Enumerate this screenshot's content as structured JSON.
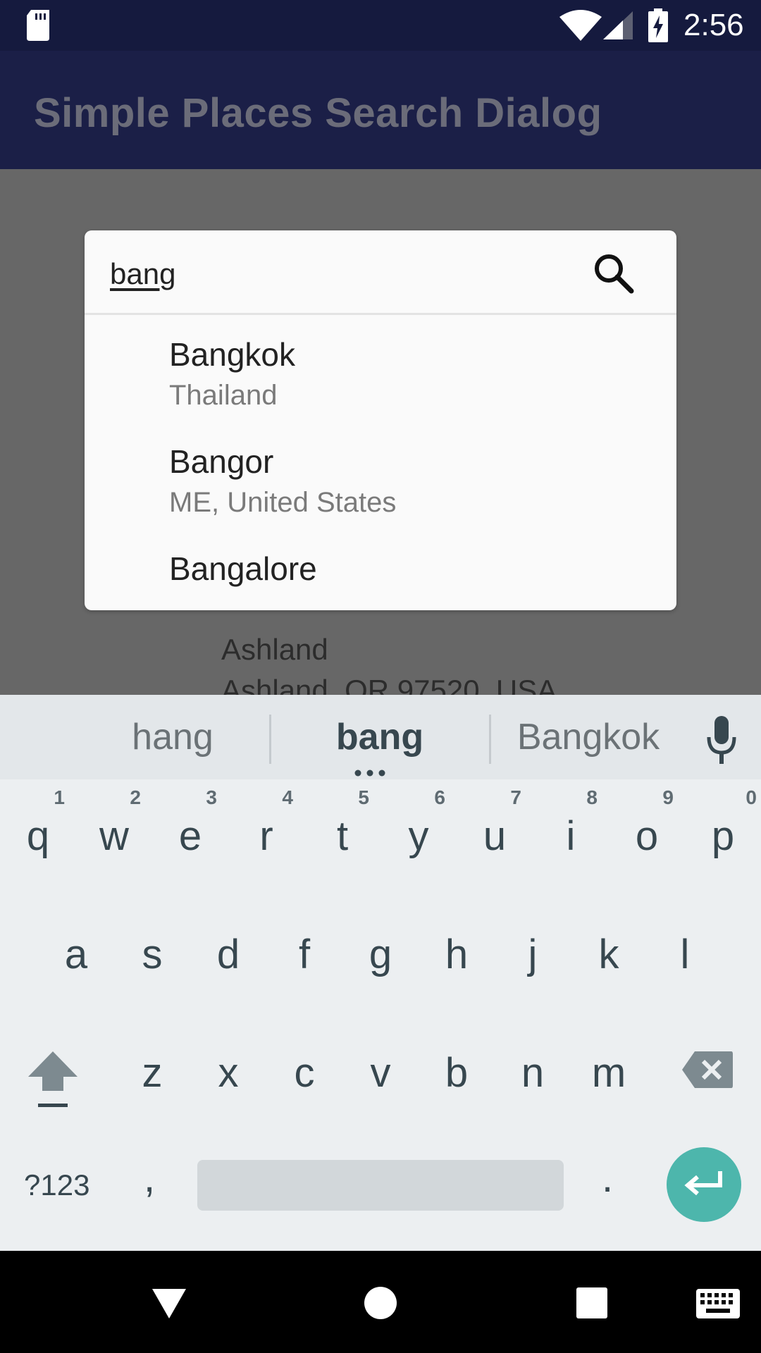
{
  "status_bar": {
    "time": "2:56",
    "icons": [
      "sd-card-icon",
      "wifi-icon",
      "signal-icon",
      "battery-charging-icon"
    ]
  },
  "app_bar": {
    "title": "Simple Places Search Dialog"
  },
  "background_list": {
    "title": "Ashland",
    "subtitle": "Ashland, OR 97520, USA"
  },
  "dialog": {
    "query": "bang",
    "search_icon": "search-icon",
    "results": [
      {
        "title": "Bangkok",
        "subtitle": "Thailand"
      },
      {
        "title": "Bangor",
        "subtitle": "ME, United States"
      },
      {
        "title": "Bangalore",
        "subtitle": ""
      }
    ]
  },
  "keyboard": {
    "suggestions": [
      "hang",
      "bang",
      "Bangkok"
    ],
    "row1": [
      {
        "k": "q",
        "h": "1"
      },
      {
        "k": "w",
        "h": "2"
      },
      {
        "k": "e",
        "h": "3"
      },
      {
        "k": "r",
        "h": "4"
      },
      {
        "k": "t",
        "h": "5"
      },
      {
        "k": "y",
        "h": "6"
      },
      {
        "k": "u",
        "h": "7"
      },
      {
        "k": "i",
        "h": "8"
      },
      {
        "k": "o",
        "h": "9"
      },
      {
        "k": "p",
        "h": "0"
      }
    ],
    "row2": [
      "a",
      "s",
      "d",
      "f",
      "g",
      "h",
      "j",
      "k",
      "l"
    ],
    "row3": [
      "z",
      "x",
      "c",
      "v",
      "b",
      "n",
      "m"
    ],
    "symbols_label": "?123",
    "comma": ",",
    "period": ".",
    "icons": [
      "mic-icon",
      "shift-icon",
      "backspace-icon",
      "enter-icon"
    ]
  },
  "nav_bar": {
    "icons": [
      "back-icon",
      "home-icon",
      "recents-icon",
      "keyboard-switch-icon"
    ]
  },
  "colors": {
    "status_bar": "#151a3e",
    "app_bar": "#1b1f47",
    "scrim": "#676767",
    "enter_key": "#4db6ac"
  }
}
